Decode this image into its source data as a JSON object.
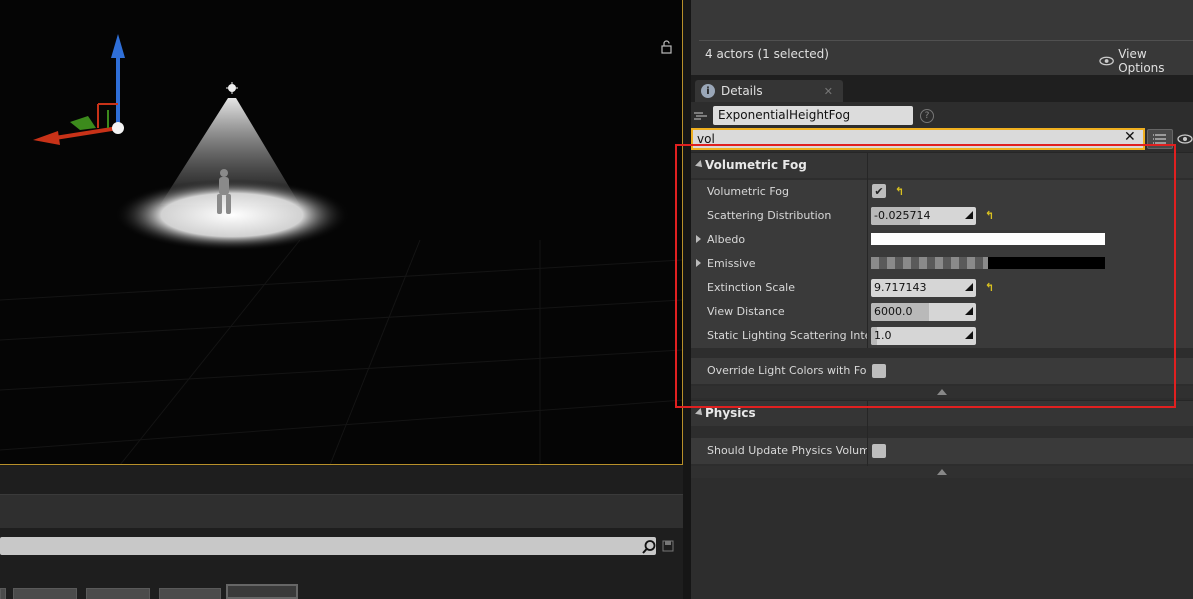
{
  "outliner": {
    "actors_count": "4 actors (1 selected)",
    "view_options_label": "View Options"
  },
  "details": {
    "tab_label": "Details",
    "actor_name": "ExponentialHeightFog",
    "search_value": "vol"
  },
  "categories": [
    {
      "label": "Volumetric Fog",
      "properties": [
        {
          "name": "Volumetric Fog",
          "type": "checkbox",
          "checked": true,
          "reset": true
        },
        {
          "name": "Scattering Distribution",
          "type": "number",
          "value": "-0.025714",
          "fill": 0.47,
          "reset": true
        },
        {
          "name": "Albedo",
          "type": "color",
          "color": "#ffffff",
          "expandable": true
        },
        {
          "name": "Emissive",
          "type": "color",
          "color": "#000000",
          "expandable": true
        },
        {
          "name": "Extinction Scale",
          "type": "number",
          "value": "9.717143",
          "fill": 0.0,
          "reset": true
        },
        {
          "name": "View Distance",
          "type": "number",
          "value": "6000.0",
          "fill": 0.55
        },
        {
          "name": "Static Lighting Scattering Intens",
          "type": "number",
          "value": "1.0",
          "fill": 0.06
        },
        {
          "name": "Override Light Colors with Fog Ir",
          "type": "checkbox",
          "checked": false
        }
      ]
    },
    {
      "label": "Physics",
      "properties": [
        {
          "name": "Should Update Physics Volume",
          "type": "checkbox",
          "checked": false
        }
      ]
    }
  ],
  "colors": {
    "accent_outline": "#e02020",
    "focus_border": "#f0b020",
    "viewport_border": "#b8902a"
  }
}
